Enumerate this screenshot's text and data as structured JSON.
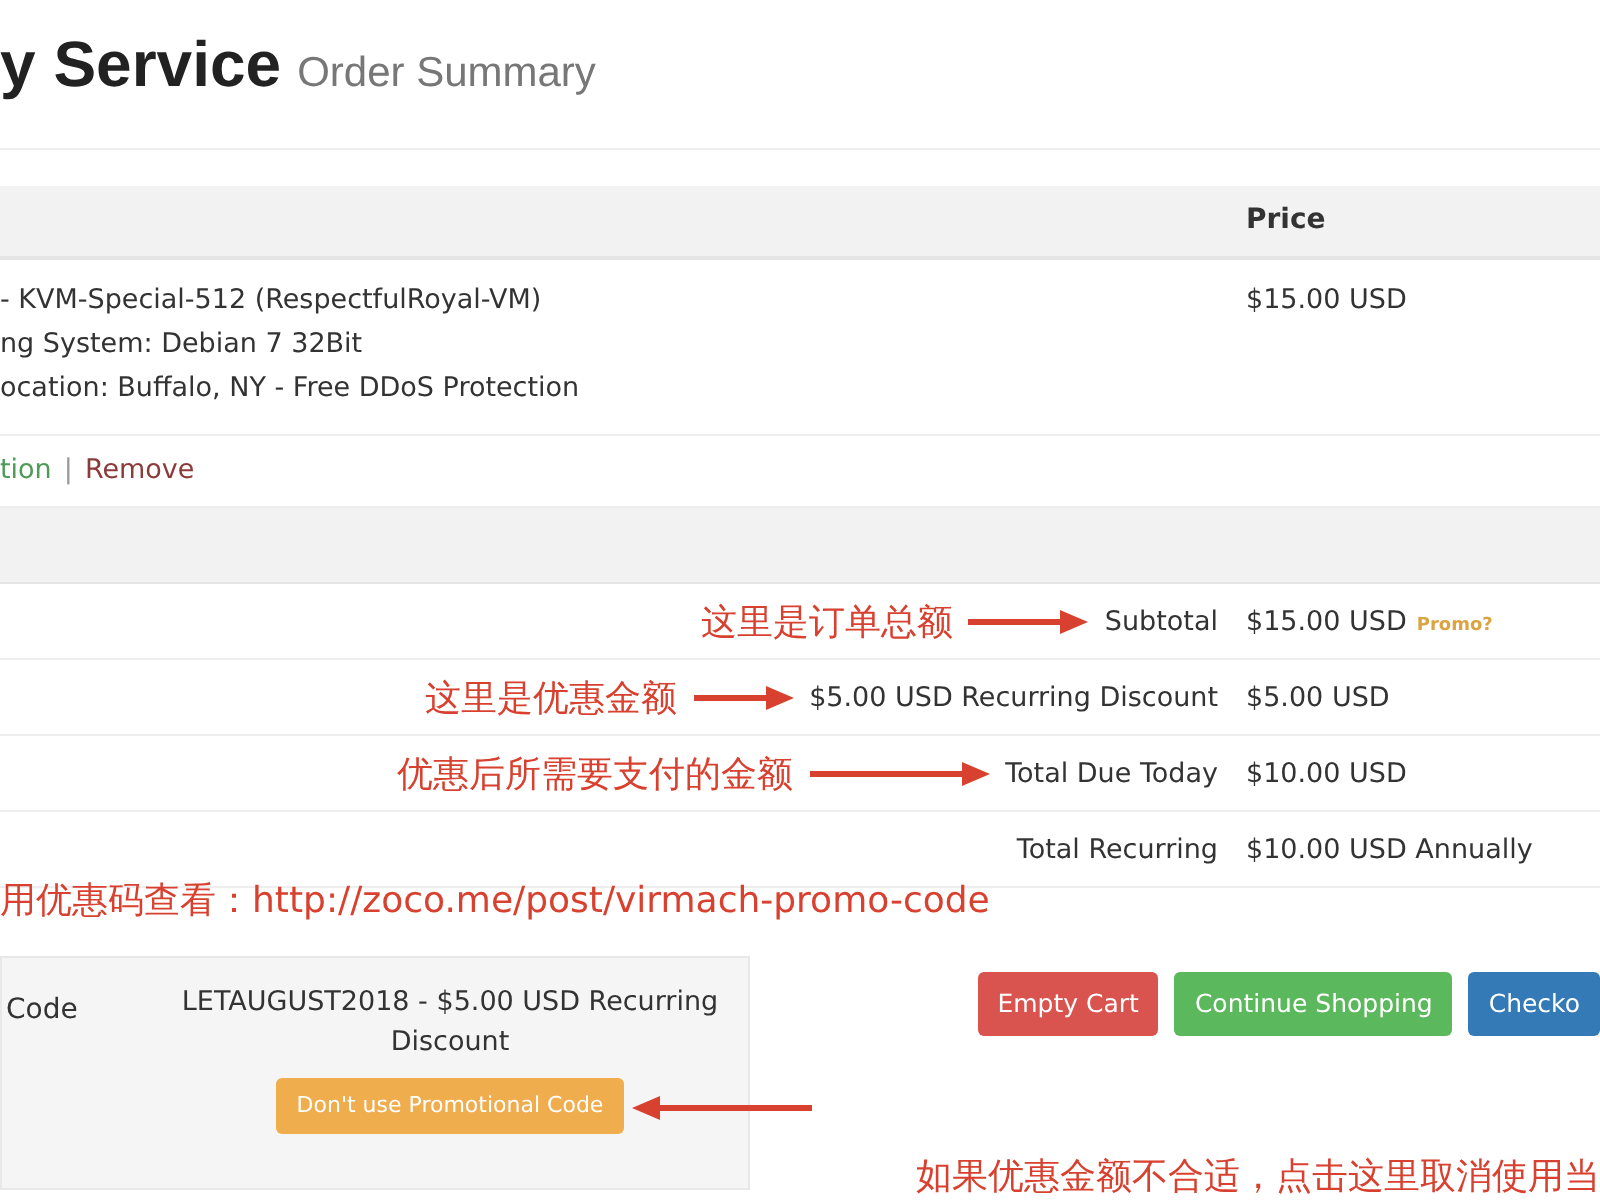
{
  "header": {
    "title": "y Service",
    "subtitle": "Order Summary"
  },
  "cart": {
    "price_header": "Price",
    "items": [
      {
        "lines": [
          "- KVM-Special-512 (RespectfulRoyal-VM)",
          "ng System: Debian 7 32Bit",
          "ocation: Buffalo, NY - Free DDoS Protection"
        ],
        "price": "$15.00 USD",
        "links": [
          {
            "label": "tion",
            "kind": "edit"
          },
          {
            "label": "Remove",
            "kind": "remove"
          }
        ],
        "separator": "|"
      }
    ]
  },
  "totals": [
    {
      "note": "这里是订单总额",
      "label": "Subtotal",
      "value": "$15.00 USD",
      "tag": "Promo?"
    },
    {
      "note": "这里是优惠金额",
      "label": "$5.00 USD Recurring Discount",
      "value": "$5.00 USD"
    },
    {
      "note": "优惠后所需要支付的金额",
      "label": "Total Due Today",
      "value": "$10.00 USD"
    },
    {
      "label": "Total Recurring",
      "value": "$10.00 USD Annually"
    }
  ],
  "promo_note": "用优惠码查看：http://zoco.me/post/virmach-promo-code",
  "promo": {
    "label": "Code",
    "applied": "LETAUGUST2018 - $5.00 USD Recurring Discount",
    "button": "Don't use Promotional Code"
  },
  "buttons": [
    {
      "label": "Empty Cart",
      "kind": "danger"
    },
    {
      "label": "Continue Shopping",
      "kind": "success"
    },
    {
      "label": "Checko",
      "kind": "primary"
    }
  ],
  "button_note": "如果优惠金额不合适，点击这里取消使用当"
}
